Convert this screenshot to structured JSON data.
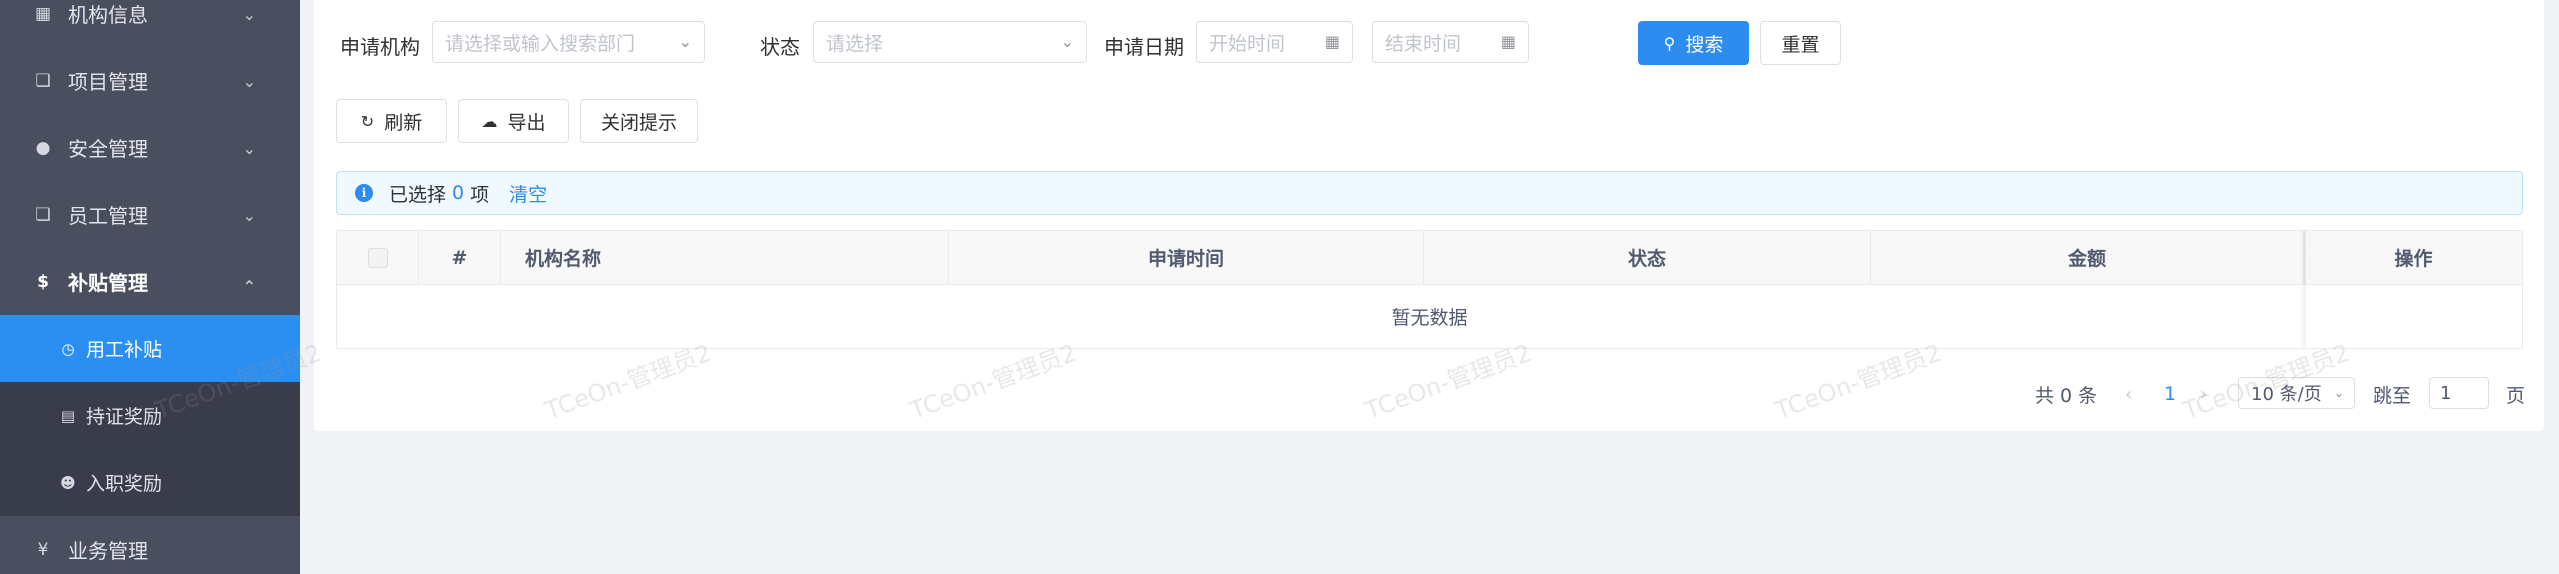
{
  "sidebar": {
    "items": [
      {
        "label": "机构信息",
        "icon": "grid-icon"
      },
      {
        "label": "项目管理",
        "icon": "copy-icon"
      },
      {
        "label": "安全管理",
        "icon": "pin-icon"
      },
      {
        "label": "员工管理",
        "icon": "copy-icon"
      },
      {
        "label": "补贴管理",
        "icon": "dollar-icon",
        "expanded": true
      },
      {
        "label": "业务管理",
        "icon": "yen-icon"
      }
    ],
    "subitems": [
      {
        "label": "用工补贴",
        "icon": "clock-icon",
        "active": true
      },
      {
        "label": "持证奖励",
        "icon": "card-icon"
      },
      {
        "label": "入职奖励",
        "icon": "user-add-icon"
      }
    ],
    "active_color": "#2b8ff2"
  },
  "filters": {
    "org_label": "申请机构",
    "org_placeholder": "请选择或输入搜索部门",
    "status_label": "状态",
    "status_placeholder": "请选择",
    "date_label": "申请日期",
    "start_placeholder": "开始时间",
    "end_placeholder": "结束时间",
    "search_label": "搜索",
    "reset_label": "重置"
  },
  "toolbar": {
    "refresh_label": "刷新",
    "export_label": "导出",
    "close_tip_label": "关闭提示"
  },
  "alert": {
    "prefix": "已选择",
    "count": "0",
    "suffix": "项",
    "clear_label": "清空"
  },
  "table": {
    "columns": [
      "#",
      "机构名称",
      "申请时间",
      "状态",
      "金额",
      "操作"
    ],
    "empty_text": "暂无数据"
  },
  "pagination": {
    "total_text": "共 0 条",
    "current_page": "1",
    "page_size": "10 条/页",
    "jump_label": "跳至",
    "jump_value": "1",
    "page_suffix": "页"
  },
  "watermark": "TCeOn-管理员2",
  "colors": {
    "primary": "#2d8cf0",
    "sidebar_bg": "#4a4f60",
    "submenu_bg": "#383c4b"
  }
}
